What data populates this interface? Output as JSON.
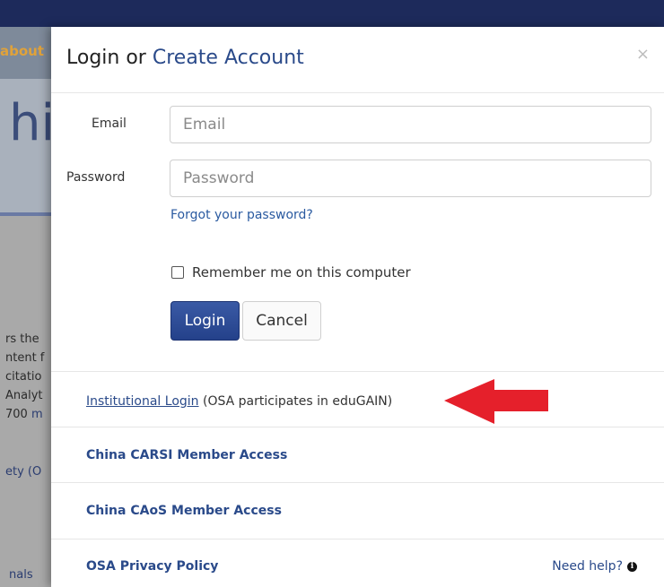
{
  "background": {
    "nav_about": "about",
    "hero_text": "hi",
    "lines": [
      "rs the",
      "ntent f",
      "citatio",
      "Analyt",
      "700"
    ],
    "line_link": "m",
    "society": "ety (O",
    "journals": "nals"
  },
  "modal": {
    "title_prefix": "Login or",
    "title_link": "Create Account",
    "close": "×",
    "email_label": "Email",
    "email_placeholder": "Email",
    "password_label": "Password",
    "password_placeholder": "Password",
    "forgot": "Forgot your password?",
    "remember": "Remember me on this computer",
    "login": "Login",
    "cancel": "Cancel",
    "institutional_link": "Institutional Login",
    "institutional_note": " (OSA participates in eduGAIN)",
    "carsi": "China CARSI Member Access",
    "caos": "China CAoS Member Access",
    "privacy": "OSA Privacy Policy",
    "help": "Need help?"
  },
  "colors": {
    "arrow": "#e5202b",
    "brand_blue": "#2a4a8a",
    "login_button": "#24418a"
  }
}
